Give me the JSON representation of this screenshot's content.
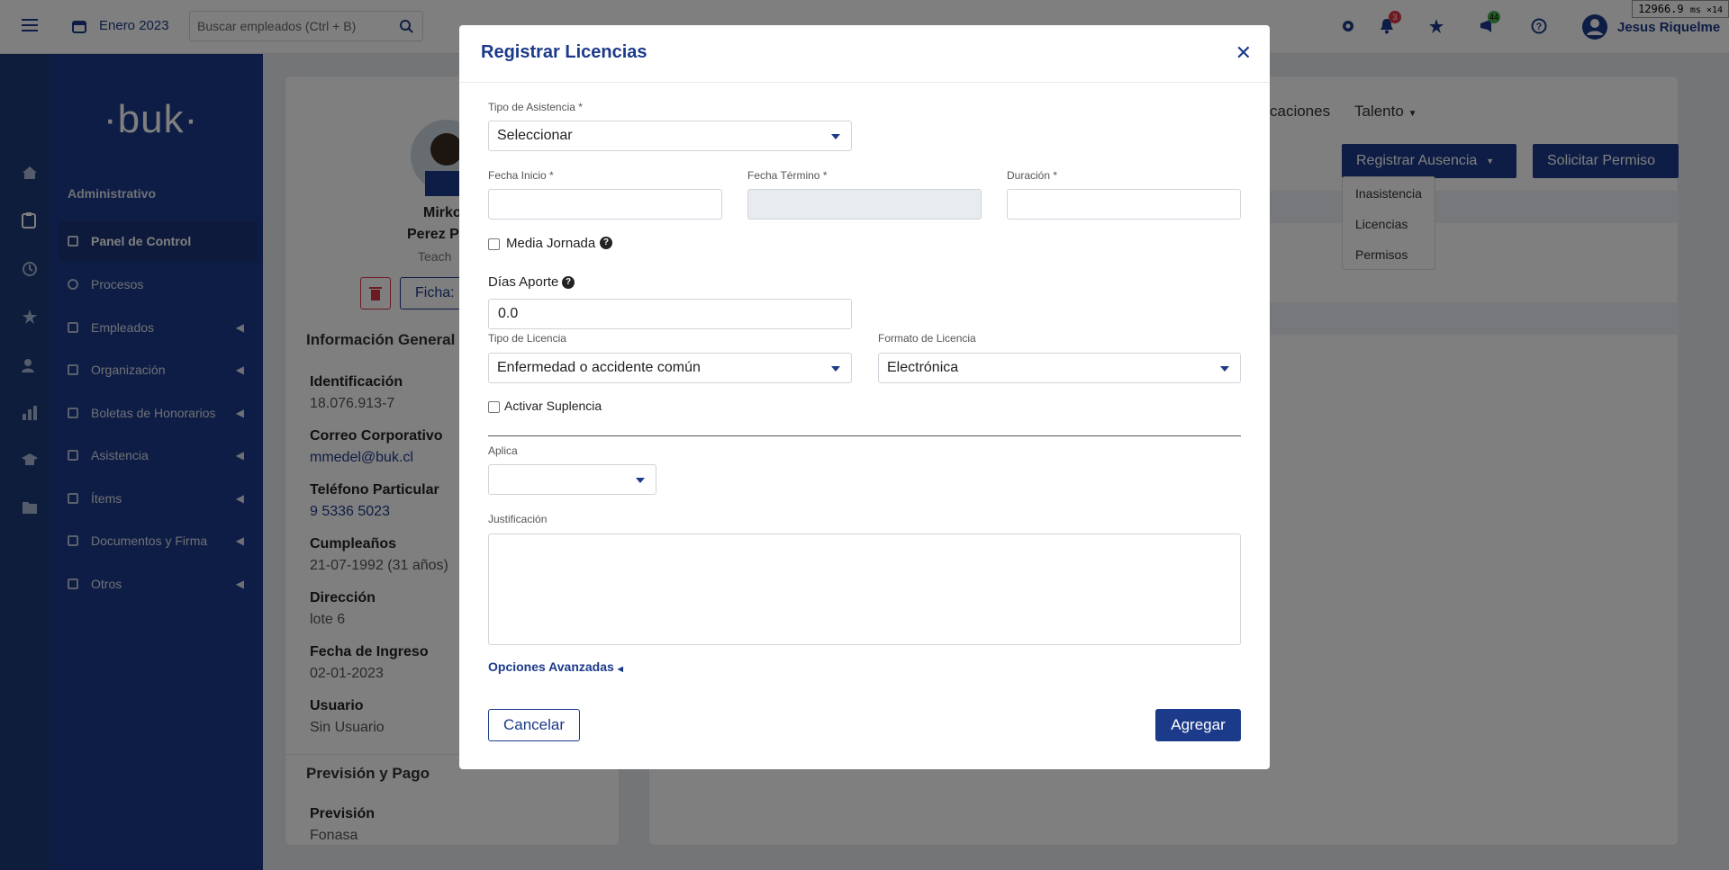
{
  "topbar": {
    "period": "Enero 2023",
    "search_placeholder": "Buscar empleados (Ctrl + B)",
    "notifications_count": "3",
    "messages_count": "44",
    "user_name": "Jesus Riquelme",
    "perf_readout": "12966.9",
    "perf_unit": "ms ×14"
  },
  "sidebar": {
    "logo": "·buk·",
    "section": "Administrativo",
    "items": [
      {
        "label": "Panel de Control",
        "has_children": false
      },
      {
        "label": "Procesos",
        "has_children": false
      },
      {
        "label": "Empleados",
        "has_children": true
      },
      {
        "label": "Organización",
        "has_children": true
      },
      {
        "label": "Boletas de Honorarios",
        "has_children": true
      },
      {
        "label": "Asistencia",
        "has_children": true
      },
      {
        "label": "Ítems",
        "has_children": true
      },
      {
        "label": "Documentos y Firma",
        "has_children": true
      },
      {
        "label": "Otros",
        "has_children": true
      }
    ]
  },
  "profile": {
    "name_line1": "Mirko",
    "name_line2": "Perez P",
    "role": "Teach",
    "ficha_label": "Ficha:",
    "section_title": "Información General",
    "fields": [
      {
        "label": "Identificación",
        "value": "18.076.913-7"
      },
      {
        "label": "Correo Corporativo",
        "value": "mmedel@buk.cl"
      },
      {
        "label": "Teléfono Particular",
        "value": "9 5336 5023"
      },
      {
        "label": "Cumpleaños",
        "value": "21-07-1992 (31 años)"
      },
      {
        "label": "Dirección",
        "value": "lote 6"
      },
      {
        "label": "Fecha de Ingreso",
        "value": "02-01-2023"
      },
      {
        "label": "Usuario",
        "value": "Sin Usuario"
      }
    ],
    "section2_title": "Previsión y Pago",
    "prevision_label": "Previsión",
    "prevision_value": "Fonasa"
  },
  "right_panel": {
    "tab_partial": "caciones",
    "tab_talento": "Talento",
    "register_absence": "Registrar Ausencia",
    "request_permission": "Solicitar Permiso",
    "absence_menu": [
      "Inasistencia",
      "Licencias",
      "Permisos"
    ]
  },
  "modal": {
    "title": "Registrar Licencias",
    "tipo_asistencia_label": "Tipo de Asistencia *",
    "tipo_asistencia_value": "Seleccionar",
    "fecha_inicio_label": "Fecha Inicio *",
    "fecha_termino_label": "Fecha Término *",
    "duracion_label": "Duración *",
    "media_jornada_label": "Media Jornada",
    "dias_aporte_label": "Días Aporte",
    "dias_aporte_value": "0.0",
    "tipo_licencia_label": "Tipo de Licencia",
    "tipo_licencia_value": "Enfermedad o accidente común",
    "formato_licencia_label": "Formato de Licencia",
    "formato_licencia_value": "Electrónica",
    "activar_suplencia_label": "Activar Suplencia",
    "aplica_label": "Aplica",
    "justificacion_label": "Justificación",
    "opciones_avanzadas": "Opciones Avanzadas",
    "cancel_label": "Cancelar",
    "submit_label": "Agregar"
  },
  "colors": {
    "brand": "#1c3a8a",
    "sidebar": "#1c3a8a",
    "overlay": "rgba(0,0,0,0.5)"
  }
}
